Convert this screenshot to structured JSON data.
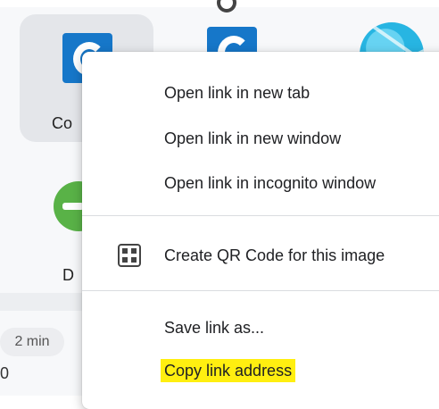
{
  "background": {
    "tile_label": "Co",
    "second_tile_label": "D",
    "time_chip": "2 min",
    "bottom_glyph": "0"
  },
  "context_menu": {
    "items": [
      {
        "label": "Open link in new tab"
      },
      {
        "label": "Open link in new window"
      },
      {
        "label": "Open link in incognito window"
      },
      {
        "label": "Create QR Code for this image",
        "icon": "qr-code-icon"
      },
      {
        "label": "Save link as..."
      },
      {
        "label": "Copy link address",
        "highlighted": true
      }
    ]
  },
  "colors": {
    "highlight": "#ffef10",
    "app_blue": "#1677c9",
    "menu_bg": "#ffffff",
    "divider": "#dadce0"
  }
}
